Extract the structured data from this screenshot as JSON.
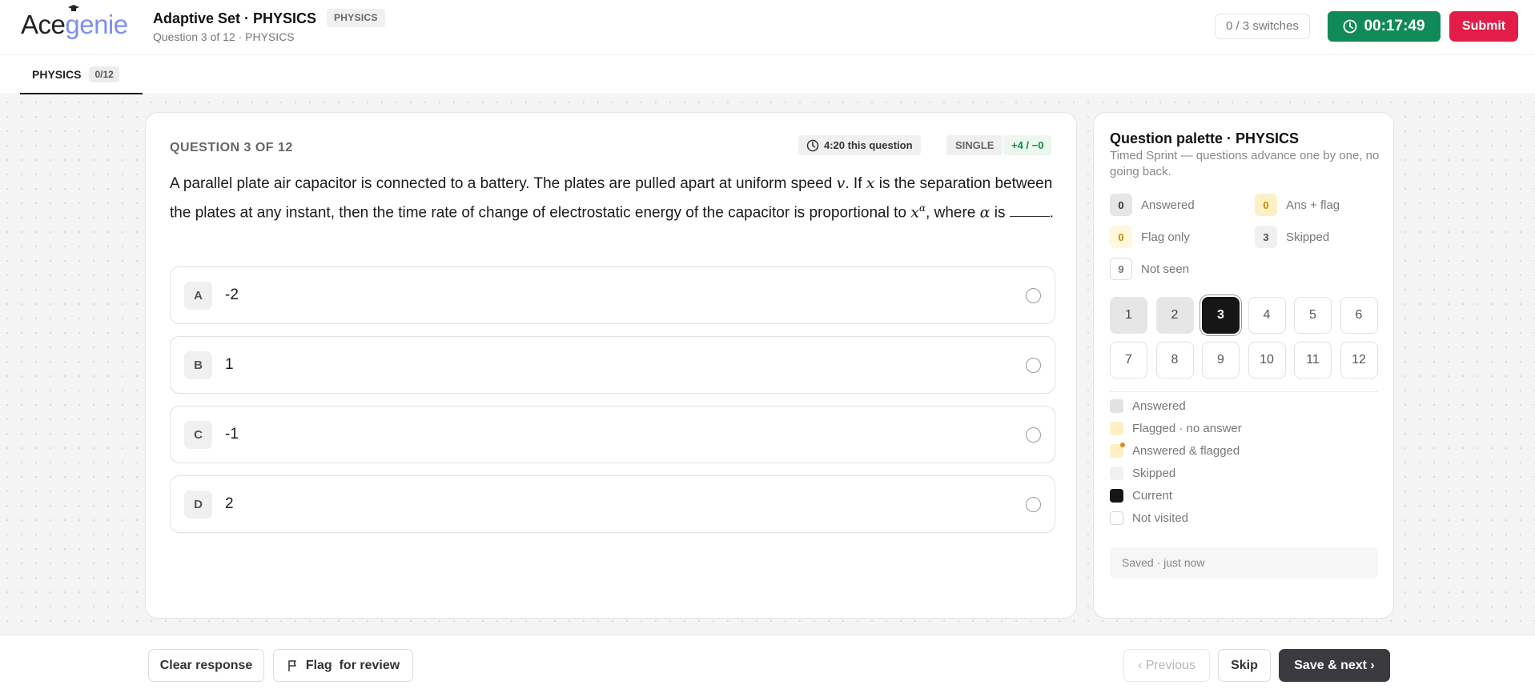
{
  "header": {
    "logo_part1": "Ace",
    "logo_part2": "genie",
    "set_title": "Adaptive Set · PHYSICS",
    "subject_tag": "PHYSICS",
    "subtitle": "Question 3 of 12 · PHYSICS",
    "switches": "0 / 3 switches",
    "timer": "00:17:49",
    "submit_label": "Submit"
  },
  "tabs": [
    {
      "label": "PHYSICS",
      "count": "0/12"
    }
  ],
  "question": {
    "number_label": "QUESTION 3 OF 12",
    "time_label": "4:20 this question",
    "type_label": "SINGLE",
    "marks_label": "+4 / −0",
    "text_part1": "A parallel plate air capacitor is connected to a battery. The plates are pulled apart at uniform speed ",
    "var_v": "v",
    "text_part2": ". If ",
    "var_x": "x",
    "text_part3": " is the separation between the plates at any instant, then the time rate of change of electrostatic energy of the capacitor is proportional to ",
    "var_x2": "x",
    "sup_alpha": "α",
    "text_part4": ", where ",
    "var_alpha": "α",
    "text_part5": " is ",
    "text_end": ".",
    "options": [
      {
        "letter": "A",
        "text": "-2"
      },
      {
        "letter": "B",
        "text": "1"
      },
      {
        "letter": "C",
        "text": "-1"
      },
      {
        "letter": "D",
        "text": "2"
      }
    ]
  },
  "palette": {
    "title": "Question palette · PHYSICS",
    "description": "Timed Sprint — questions advance one by one, no going back.",
    "stats": {
      "answered": {
        "count": "0",
        "label": "Answered"
      },
      "ans_flag": {
        "count": "0",
        "label": "Ans + flag"
      },
      "flag_only": {
        "count": "0",
        "label": "Flag only"
      },
      "skipped": {
        "count": "3",
        "label": "Skipped"
      },
      "not_seen": {
        "count": "9",
        "label": "Not seen"
      }
    },
    "questions": [
      "1",
      "2",
      "3",
      "4",
      "5",
      "6",
      "7",
      "8",
      "9",
      "10",
      "11",
      "12"
    ],
    "question_states": [
      "answered",
      "answered",
      "current",
      "not-visited",
      "not-visited",
      "not-visited",
      "not-visited",
      "not-visited",
      "not-visited",
      "not-visited",
      "not-visited",
      "not-visited"
    ],
    "legend": {
      "answered": "Answered",
      "flagged": "Flagged · no answer",
      "ans_flagged": "Answered & flagged",
      "skipped": "Skipped",
      "current": "Current",
      "not_visited": "Not visited"
    },
    "saved_status": "Saved · just now"
  },
  "footer": {
    "clear_label": "Clear response",
    "flag_label": "Flag  for review",
    "previous_label": "‹ Previous",
    "skip_label": "Skip",
    "save_next_label": "Save & next ›"
  },
  "colors": {
    "timer_bg": "#118a5a",
    "submit_bg": "#e11d48",
    "logo_accent": "#7f8ff0",
    "current_bg": "#161616",
    "save_next_bg": "#3b3b3f"
  },
  "icons": {
    "timer": "clock-icon",
    "question_time": "clock-icon",
    "flag": "flag-icon",
    "logo_cap": "graduation-cap-icon"
  }
}
